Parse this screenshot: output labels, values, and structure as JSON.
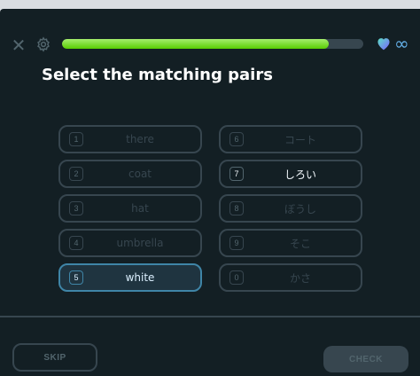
{
  "header": {
    "close_icon": "close-icon",
    "settings_icon": "gear-icon",
    "progress": 0.885,
    "progress_color": "#58cc02",
    "hearts_icon": "heart-icon",
    "hearts_value": "∞"
  },
  "title": "Select the matching pairs",
  "left_tiles": [
    {
      "num": "1",
      "word": "there",
      "state": "disabled"
    },
    {
      "num": "2",
      "word": "coat",
      "state": "disabled"
    },
    {
      "num": "3",
      "word": "hat",
      "state": "disabled"
    },
    {
      "num": "4",
      "word": "umbrella",
      "state": "disabled"
    },
    {
      "num": "5",
      "word": "white",
      "state": "selected"
    }
  ],
  "right_tiles": [
    {
      "num": "6",
      "word": "コート",
      "state": "disabled"
    },
    {
      "num": "7",
      "word": "しろい",
      "state": "active"
    },
    {
      "num": "8",
      "word": "ぼうし",
      "state": "disabled"
    },
    {
      "num": "9",
      "word": "そこ",
      "state": "disabled"
    },
    {
      "num": "0",
      "word": "かさ",
      "state": "disabled"
    }
  ],
  "footer": {
    "skip_label": "SKIP",
    "check_label": "CHECK"
  }
}
